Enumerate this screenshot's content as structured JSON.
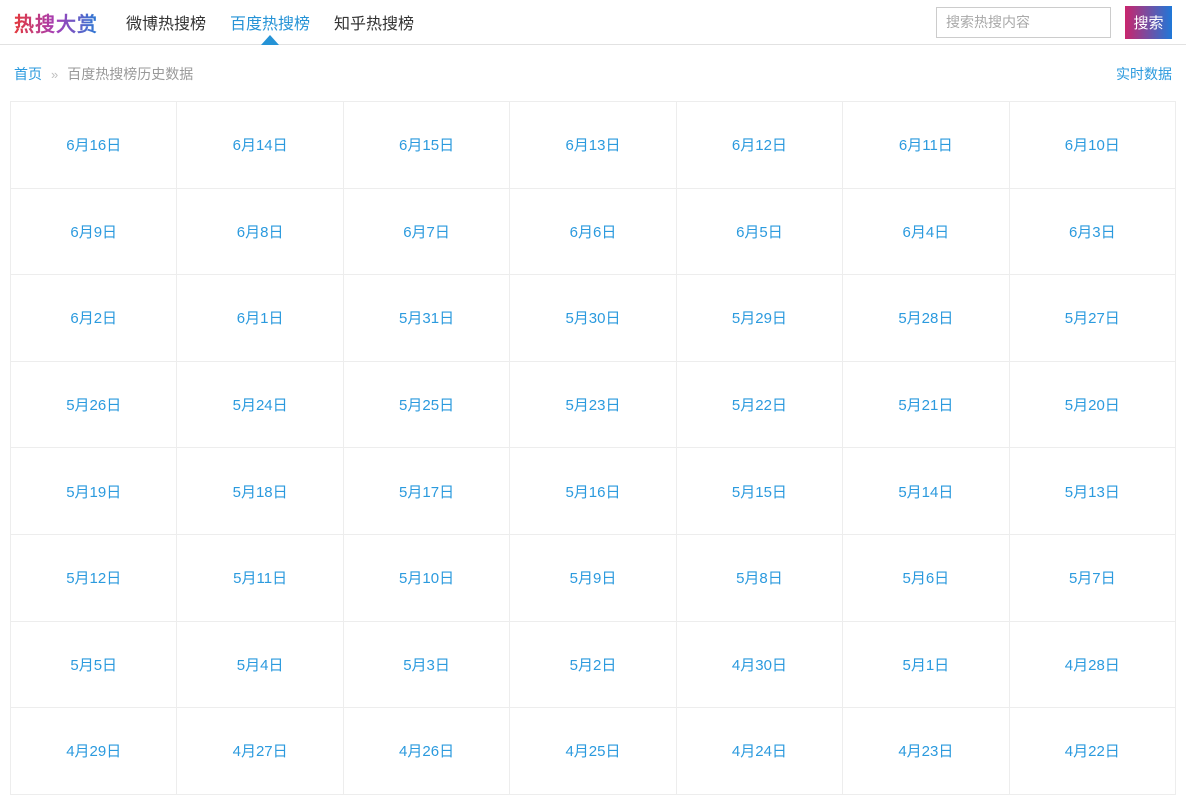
{
  "header": {
    "logo": "热搜大赏",
    "nav": [
      {
        "name": "weibo-hot-tab",
        "label": "微博热搜榜",
        "active": false
      },
      {
        "name": "baidu-hot-tab",
        "label": "百度热搜榜",
        "active": true
      },
      {
        "name": "zhihu-hot-tab",
        "label": "知乎热搜榜",
        "active": false
      }
    ],
    "search": {
      "placeholder": "搜索热搜内容",
      "button_label": "搜索"
    }
  },
  "breadcrumb": {
    "home": "首页",
    "separator": "»",
    "current": "百度热搜榜历史数据",
    "realtime_link": "实时数据"
  },
  "dates": [
    "6月16日",
    "6月14日",
    "6月15日",
    "6月13日",
    "6月12日",
    "6月11日",
    "6月10日",
    "6月9日",
    "6月8日",
    "6月7日",
    "6月6日",
    "6月5日",
    "6月4日",
    "6月3日",
    "6月2日",
    "6月1日",
    "5月31日",
    "5月30日",
    "5月29日",
    "5月28日",
    "5月27日",
    "5月26日",
    "5月24日",
    "5月25日",
    "5月23日",
    "5月22日",
    "5月21日",
    "5月20日",
    "5月19日",
    "5月18日",
    "5月17日",
    "5月16日",
    "5月15日",
    "5月14日",
    "5月13日",
    "5月12日",
    "5月11日",
    "5月10日",
    "5月9日",
    "5月8日",
    "5月6日",
    "5月7日",
    "5月5日",
    "5月4日",
    "5月3日",
    "5月2日",
    "4月30日",
    "5月1日",
    "4月28日",
    "4月29日",
    "4月27日",
    "4月26日",
    "4月25日",
    "4月24日",
    "4月23日",
    "4月22日"
  ],
  "colors": {
    "link_blue": "#2b9ade",
    "nav_active": "#2593d6",
    "text_dark": "#333333",
    "border_gray": "#e2e2e2",
    "cell_border": "#ededed",
    "logo_red": "#e4393c",
    "logo_purple": "#a43eb8",
    "logo_blue": "#2a7cd5",
    "btn_pink": "#c9256d",
    "btn_blue": "#1f78d8"
  }
}
